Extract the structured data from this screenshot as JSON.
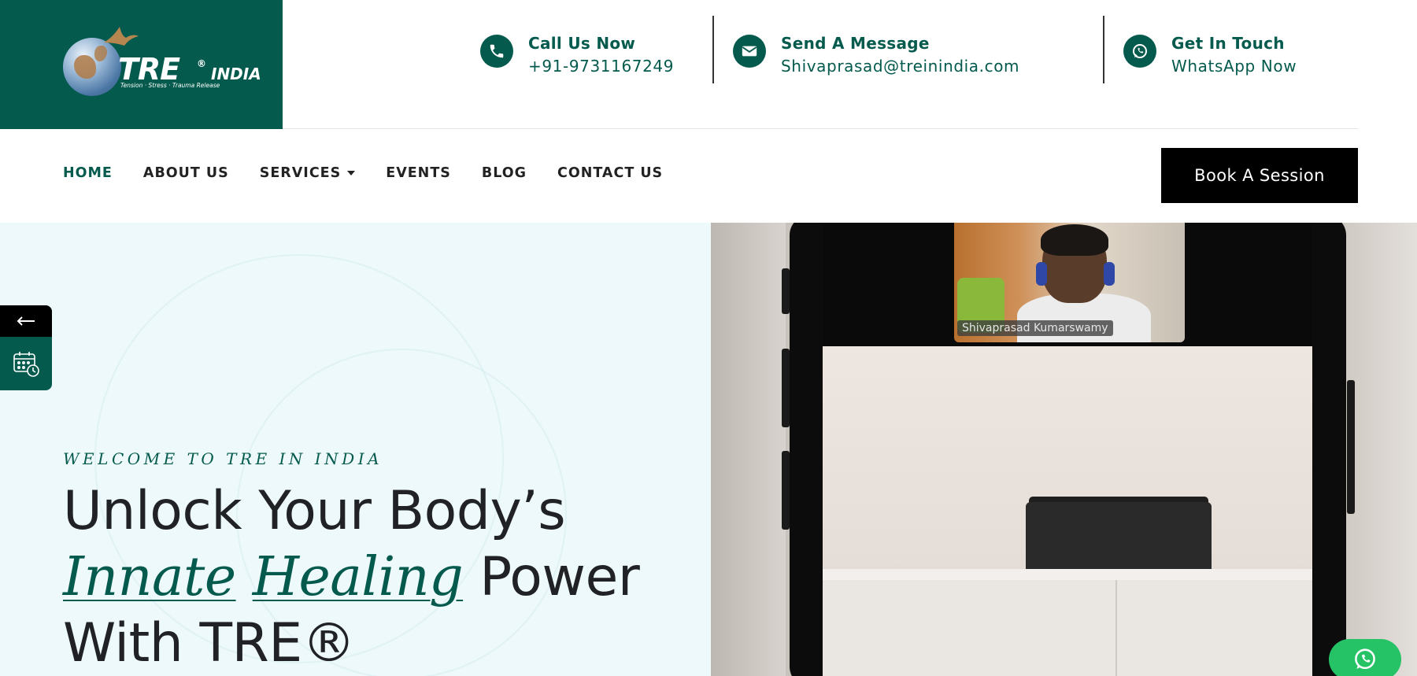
{
  "logo": {
    "brand": "TRE",
    "reg": "®",
    "suffix": "INDIA",
    "tagline": "Tension · Stress · Trauma Release"
  },
  "contacts": [
    {
      "title": "Call Us Now",
      "value": "+91-9731167249",
      "icon": "phone-icon"
    },
    {
      "title": "Send A Message",
      "value": "Shivaprasad@treinindia.com",
      "icon": "envelope-icon"
    },
    {
      "title": "Get In Touch",
      "value": "WhatsApp Now",
      "icon": "whatsapp-icon"
    }
  ],
  "nav": {
    "items": [
      {
        "label": "HOME",
        "active": true
      },
      {
        "label": "ABOUT US"
      },
      {
        "label": "SERVICES",
        "has_dropdown": true
      },
      {
        "label": "EVENTS"
      },
      {
        "label": "BLOG"
      },
      {
        "label": "CONTACT US"
      }
    ],
    "cta": "Book A Session"
  },
  "hero": {
    "eyebrow": "WELCOME TO TRE IN INDIA",
    "headline_line1": "Unlock Your Body’s",
    "headline_em1": "Innate",
    "headline_em2": "Healing",
    "headline_line2_rest": "Power",
    "headline_line3": "With TRE®",
    "video_name_label": "Shivaprasad Kumarswamy"
  },
  "side_tab": {
    "arrow_icon": "arrow-left-icon",
    "calendar_icon": "calendar-clock-icon"
  },
  "colors": {
    "brand": "#045a4d",
    "hero_bg": "#edf9fb",
    "whatsapp": "#25c266"
  }
}
